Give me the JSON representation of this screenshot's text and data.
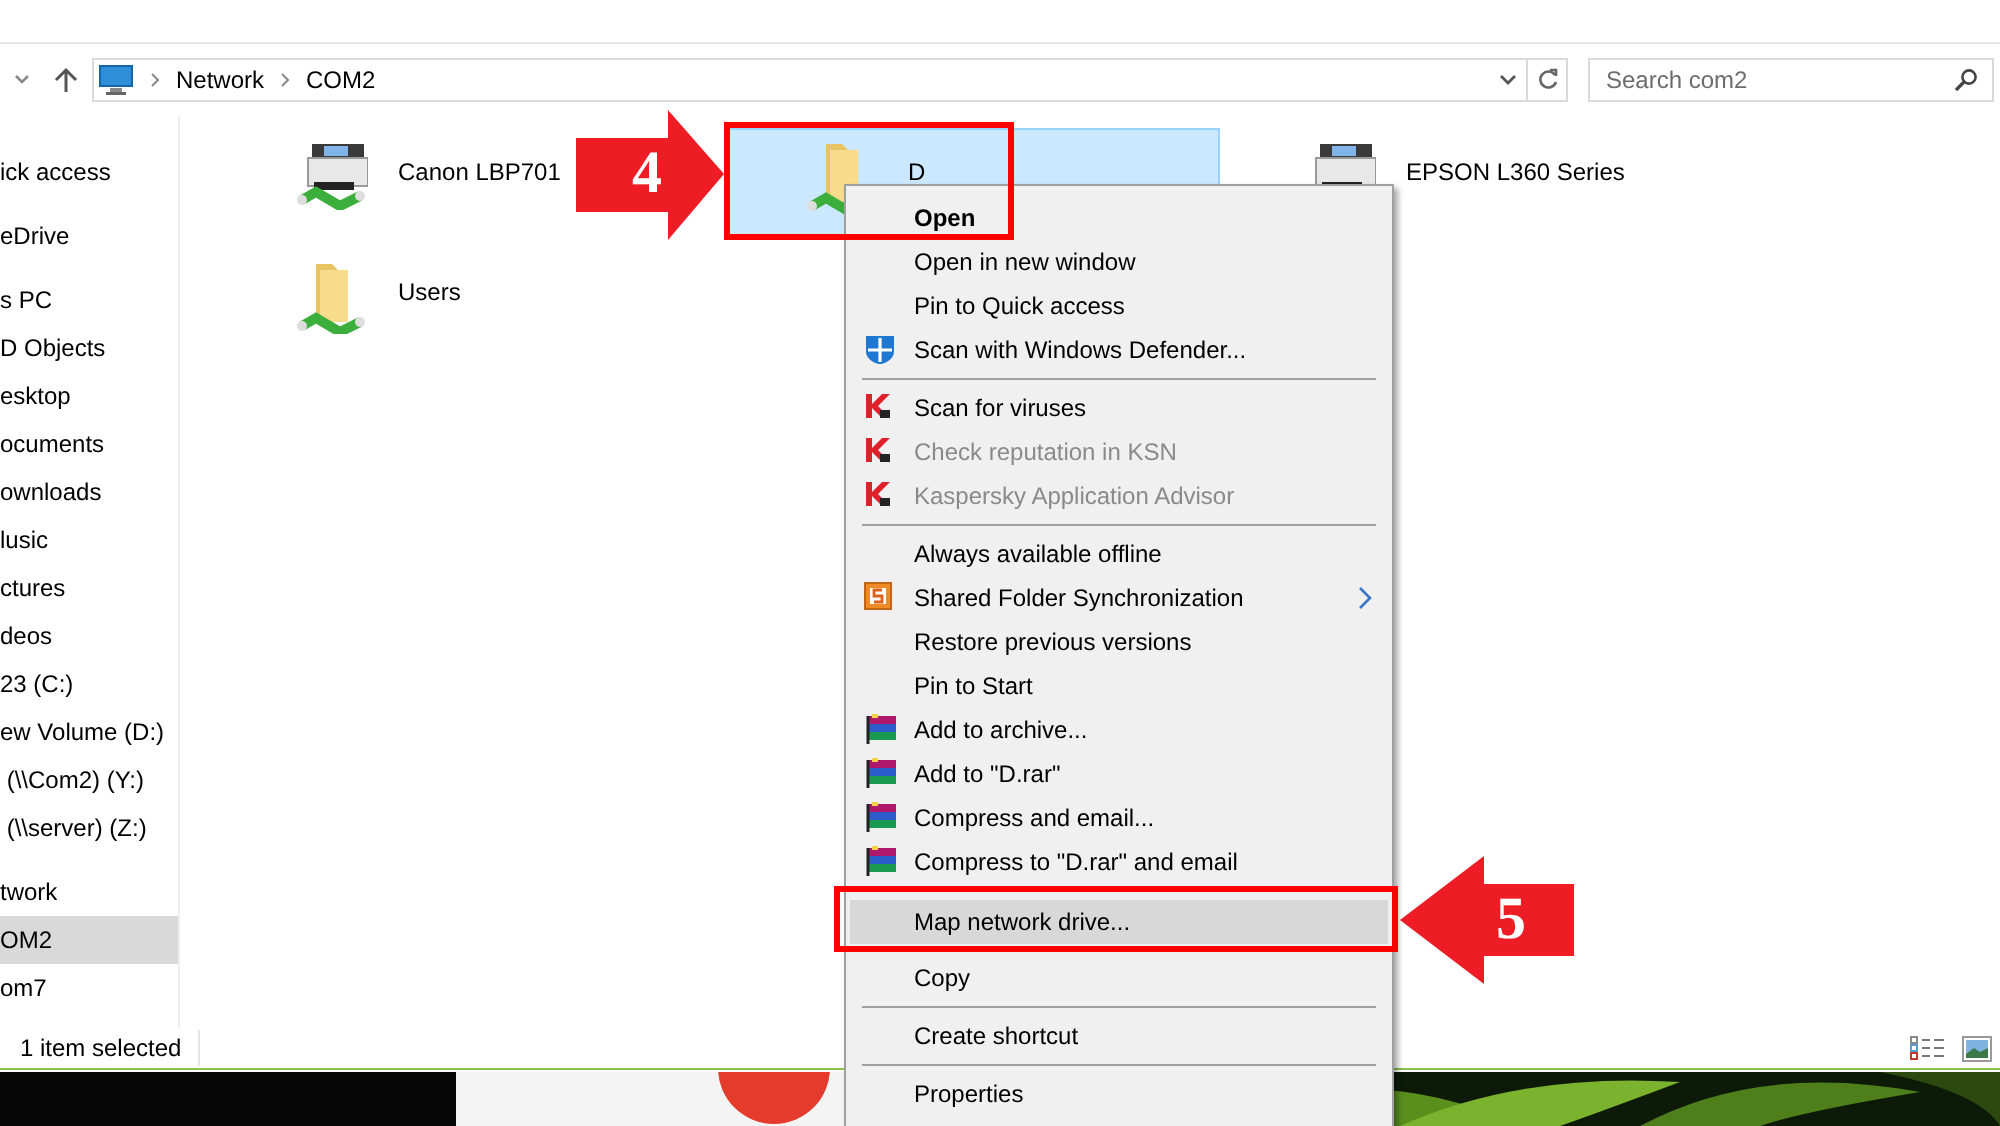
{
  "address_bar": {
    "crumbs": [
      "Network",
      "COM2"
    ]
  },
  "search": {
    "placeholder": "Search com2"
  },
  "sidebar": {
    "groups": [
      [
        {
          "label": "ick access",
          "selected": false
        }
      ],
      [
        {
          "label": "eDrive",
          "selected": false
        }
      ],
      [
        {
          "label": "s PC",
          "selected": false
        },
        {
          "label": "D Objects",
          "selected": false
        },
        {
          "label": "esktop",
          "selected": false
        },
        {
          "label": "ocuments",
          "selected": false
        },
        {
          "label": "ownloads",
          "selected": false
        },
        {
          "label": "lusic",
          "selected": false
        },
        {
          "label": "ctures",
          "selected": false
        },
        {
          "label": "deos",
          "selected": false
        },
        {
          "label": "23 (C:)",
          "selected": false
        },
        {
          "label": "ew Volume (D:)",
          "selected": false
        },
        {
          "label": " (\\\\Com2) (Y:)",
          "selected": false
        },
        {
          "label": " (\\\\server) (Z:)",
          "selected": false
        }
      ],
      [
        {
          "label": "twork",
          "selected": false
        },
        {
          "label": "OM2",
          "selected": true
        },
        {
          "label": "om7",
          "selected": false
        }
      ]
    ]
  },
  "items": [
    {
      "name": "Canon LBP701",
      "kind": "printer",
      "selected": false
    },
    {
      "name": "D",
      "kind": "folder",
      "selected": true
    },
    {
      "name": "EPSON L360 Series",
      "kind": "printer",
      "selected": false
    },
    {
      "name": "Users",
      "kind": "folder",
      "selected": false
    }
  ],
  "status_bar": {
    "text": "1 item selected"
  },
  "context_menu": [
    {
      "kind": "item",
      "label": "Open",
      "bold": true,
      "disabled": false,
      "submenu": false,
      "selected": false
    },
    {
      "kind": "item",
      "label": "Open in new window",
      "bold": false,
      "disabled": false,
      "submenu": false,
      "selected": false
    },
    {
      "kind": "item",
      "label": "Pin to Quick access",
      "bold": false,
      "disabled": false,
      "submenu": false,
      "selected": false
    },
    {
      "kind": "defender_item",
      "label": "Scan with Windows Defender...",
      "bold": false,
      "disabled": false,
      "submenu": false,
      "selected": false
    },
    {
      "kind": "separator"
    },
    {
      "kind": "antivirus_item",
      "label": "Scan for viruses",
      "bold": false,
      "disabled": false,
      "submenu": false,
      "selected": false
    },
    {
      "kind": "antivirus_item",
      "label": "Check reputation in KSN",
      "bold": false,
      "disabled": true,
      "submenu": false,
      "selected": false
    },
    {
      "kind": "antivirus_item",
      "label": "Kaspersky Application Advisor",
      "bold": false,
      "disabled": true,
      "submenu": false,
      "selected": false
    },
    {
      "kind": "separator"
    },
    {
      "kind": "item",
      "label": "Always available offline",
      "bold": false,
      "disabled": false,
      "submenu": false,
      "selected": false
    },
    {
      "kind": "sync_item",
      "label": "Shared Folder Synchronization",
      "bold": false,
      "disabled": false,
      "submenu": true,
      "selected": false
    },
    {
      "kind": "item",
      "label": "Restore previous versions",
      "bold": false,
      "disabled": false,
      "submenu": false,
      "selected": false
    },
    {
      "kind": "item",
      "label": "Pin to Start",
      "bold": false,
      "disabled": false,
      "submenu": false,
      "selected": false
    },
    {
      "kind": "archive_item",
      "label": "Add to archive...",
      "bold": false,
      "disabled": false,
      "submenu": false,
      "selected": false
    },
    {
      "kind": "archive_item",
      "label": "Add to \"D.rar\"",
      "bold": false,
      "disabled": false,
      "submenu": false,
      "selected": false
    },
    {
      "kind": "archive_item",
      "label": "Compress and email...",
      "bold": false,
      "disabled": false,
      "submenu": false,
      "selected": false
    },
    {
      "kind": "archive_item",
      "label": "Compress to \"D.rar\" and email",
      "bold": false,
      "disabled": false,
      "submenu": false,
      "selected": false
    },
    {
      "kind": "item",
      "label": "Map network drive...",
      "bold": false,
      "disabled": false,
      "submenu": false,
      "selected": true
    },
    {
      "kind": "item",
      "label": "Copy",
      "bold": false,
      "disabled": false,
      "submenu": false,
      "selected": false
    },
    {
      "kind": "separator"
    },
    {
      "kind": "item",
      "label": "Create shortcut",
      "bold": false,
      "disabled": false,
      "submenu": false,
      "selected": false
    },
    {
      "kind": "separator"
    },
    {
      "kind": "item",
      "label": "Properties",
      "bold": false,
      "disabled": false,
      "submenu": false,
      "selected": false
    }
  ],
  "annotations": [
    {
      "label": "4"
    },
    {
      "label": "5"
    }
  ]
}
